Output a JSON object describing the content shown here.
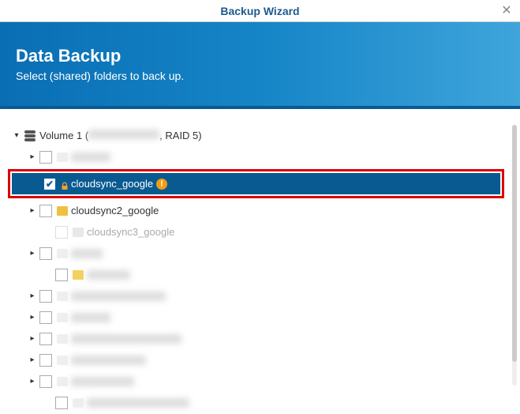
{
  "titlebar": {
    "title": "Backup Wizard"
  },
  "banner": {
    "heading": "Data Backup",
    "subtext": "Select (shared) folders to back up."
  },
  "tree": {
    "volume": {
      "label_prefix": "Volume 1 (",
      "label_suffix": ", RAID 5)"
    },
    "items": [
      {
        "label": "cloudsync_google",
        "checked": true,
        "selected": true,
        "locked": true,
        "warning": true,
        "warning_text": "!"
      },
      {
        "label": "cloudsync2_google"
      },
      {
        "label": "cloudsync3_google"
      }
    ]
  }
}
